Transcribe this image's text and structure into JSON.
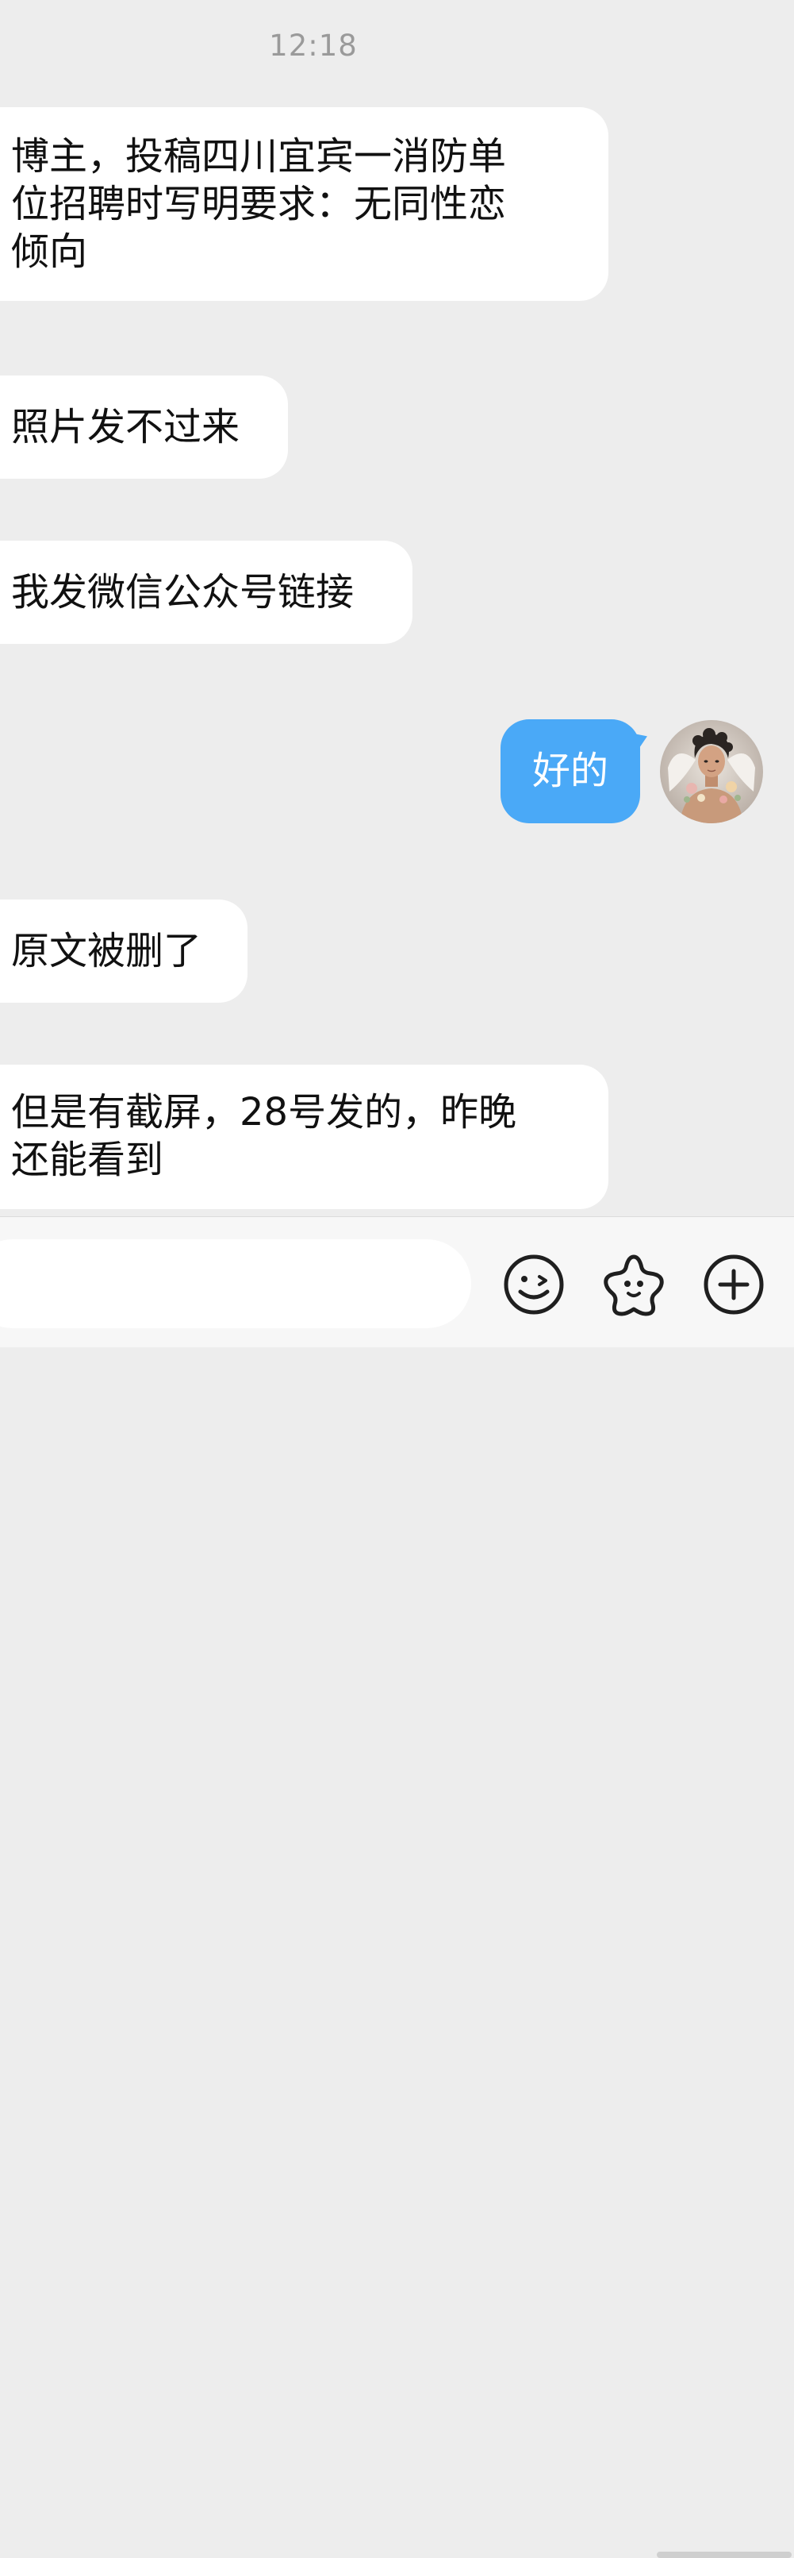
{
  "chat": {
    "timestamp": "12:18",
    "messages": [
      {
        "direction": "incoming",
        "text": "博主，投稿四川宜宾一消防单\n位招聘时写明要求：无同性恋\n倾向"
      },
      {
        "direction": "incoming",
        "text": "照片发不过来"
      },
      {
        "direction": "incoming",
        "text": "我发微信公众号链接"
      },
      {
        "direction": "outgoing",
        "text": "好的"
      },
      {
        "direction": "incoming",
        "text": "原文被删了"
      },
      {
        "direction": "incoming",
        "text": "但是有截屏，28号发的，昨晚\n还能看到"
      }
    ]
  },
  "composer": {
    "input_value": "",
    "icons": [
      "emoji-icon",
      "sticker-icon",
      "plus-icon"
    ]
  },
  "colors": {
    "background": "#ededed",
    "incoming_bubble": "#ffffff",
    "outgoing_bubble": "#4aa9f7",
    "timestamp": "#9a9a9a"
  }
}
